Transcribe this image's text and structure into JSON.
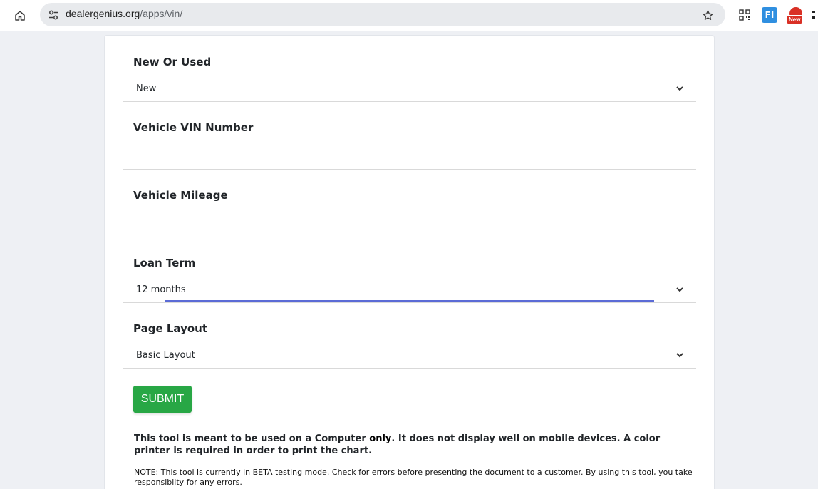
{
  "browser": {
    "url_host": "dealergenius.org",
    "url_path": "/apps/vin/",
    "extensions": {
      "fi_label": "FI",
      "new_badge": "New"
    }
  },
  "form": {
    "new_or_used": {
      "label": "New Or Used",
      "value": "New"
    },
    "vin": {
      "label": "Vehicle VIN Number",
      "value": ""
    },
    "mileage": {
      "label": "Vehicle Mileage",
      "value": ""
    },
    "loan_term": {
      "label": "Loan Term",
      "value": "12 months"
    },
    "page_layout": {
      "label": "Page Layout",
      "value": "Basic Layout"
    },
    "submit_label": "SUBMIT"
  },
  "info": {
    "text_before": "This tool is meant to be used on a Computer ",
    "emphasis": "only",
    "text_after": ". It does not display well on mobile devices. A color printer is required in order to print the chart."
  },
  "note": "NOTE: This tool is currently in BETA testing mode. Check for errors before presenting the document to a customer. By using this tool, you take responsiblity for any errors.",
  "colors": {
    "submit_bg": "#28a745",
    "focus_line": "#5b6bd6",
    "page_bg": "#eef0f4"
  }
}
